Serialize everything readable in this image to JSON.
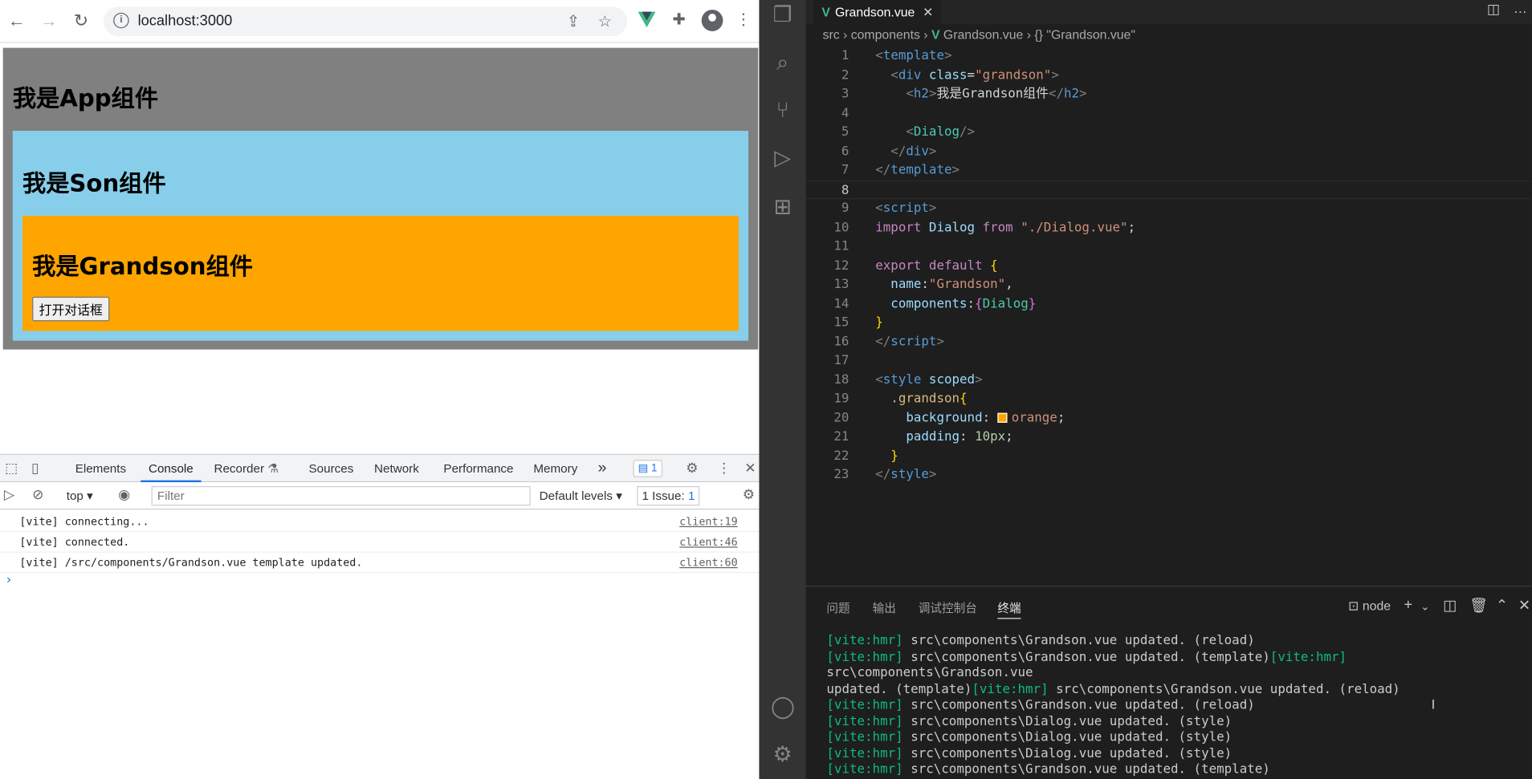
{
  "browser": {
    "url": "localhost:3000",
    "page": {
      "app_title": "我是App组件",
      "son_title": "我是Son组件",
      "grandson_title": "我是Grandson组件",
      "open_dialog_label": "打开对话框"
    },
    "devtools": {
      "tabs": [
        "Elements",
        "Console",
        "Recorder",
        "Sources",
        "Network",
        "Performance",
        "Memory"
      ],
      "active_tab": "Console",
      "issues_badge": "1",
      "context": "top",
      "filter_placeholder": "Filter",
      "levels": "Default levels",
      "issues_label": "1 Issue:",
      "issues_count": "1",
      "console_lines": [
        {
          "msg": "[vite] connecting...",
          "src": "client:19"
        },
        {
          "msg": "[vite] connected.",
          "src": "client:46"
        },
        {
          "msg": "[vite] /src/components/Grandson.vue template updated.",
          "src": "client:60"
        }
      ]
    }
  },
  "vscode": {
    "tab_title": "Grandson.vue",
    "breadcrumb": {
      "p1": "src",
      "p2": "components",
      "p3": "Grandson.vue",
      "p4": "\"Grandson.vue\""
    },
    "line_numbers": [
      "1",
      "2",
      "3",
      "4",
      "5",
      "6",
      "7",
      "8",
      "9",
      "10",
      "11",
      "12",
      "13",
      "14",
      "15",
      "16",
      "17",
      "18",
      "19",
      "20",
      "21",
      "22",
      "23"
    ],
    "code": {
      "l3_text": "我是Grandson组件",
      "l10_path": "\"./Dialog.vue\"",
      "l13_name": "\"Grandson\"",
      "l20_value": "orange",
      "l21_value": "10px"
    },
    "panel_tabs": [
      "问题",
      "输出",
      "调试控制台",
      "终端"
    ],
    "active_panel_tab": "终端",
    "terminal_name": "node",
    "terminal_lines": [
      {
        "tag": "[vite:hmr]",
        "text": " src\\components\\Grandson.vue updated. (reload)"
      },
      {
        "tag": "[vite:hmr]",
        "text": " src\\components\\Grandson.vue updated. (template)",
        "tag2": "[vite:hmr]",
        "text2": " src\\components\\Grandson.vue"
      },
      {
        "text": " updated. (template)",
        "tag": "[vite:hmr]",
        "text2": " src\\components\\Grandson.vue updated. (reload)"
      },
      {
        "tag": "[vite:hmr]",
        "text": " src\\components\\Grandson.vue updated. (reload)"
      },
      {
        "tag": "[vite:hmr]",
        "text": " src\\components\\Dialog.vue updated. (style)"
      },
      {
        "tag": "[vite:hmr]",
        "text": " src\\components\\Dialog.vue updated. (style)"
      },
      {
        "tag": "[vite:hmr]",
        "text": " src\\components\\Dialog.vue updated. (style)"
      },
      {
        "tag": "[vite:hmr]",
        "text": " src\\components\\Grandson.vue updated. (template)"
      }
    ]
  }
}
